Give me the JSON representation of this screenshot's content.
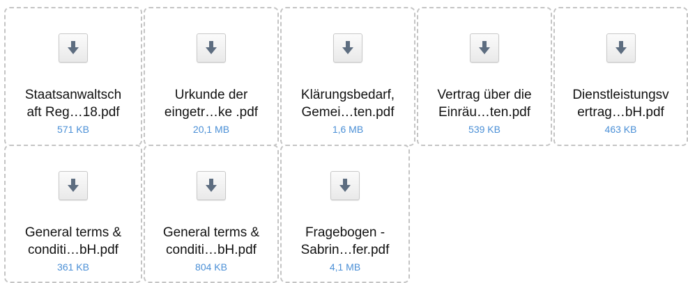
{
  "attachments": [
    {
      "line1": "Staatsanwaltsch",
      "line2": "aft Reg…18.pdf",
      "size": "571 KB",
      "icon": "download-arrow-icon"
    },
    {
      "line1": "Urkunde der",
      "line2": "eingetr…ke .pdf",
      "size": "20,1 MB",
      "icon": "download-arrow-icon"
    },
    {
      "line1": "Klärungsbedarf,",
      "line2": "Gemei…ten.pdf",
      "size": "1,6 MB",
      "icon": "download-arrow-icon"
    },
    {
      "line1": "Vertrag über die",
      "line2": "Einräu…ten.pdf",
      "size": "539 KB",
      "icon": "download-arrow-icon"
    },
    {
      "line1": "Dienstleistungsv",
      "line2": "ertrag…bH.pdf",
      "size": "463 KB",
      "icon": "download-arrow-icon"
    },
    {
      "line1": "General terms &",
      "line2": "conditi…bH.pdf",
      "size": "361 KB",
      "icon": "download-arrow-icon"
    },
    {
      "line1": "General terms &",
      "line2": "conditi…bH.pdf",
      "size": "804 KB",
      "icon": "download-arrow-icon"
    },
    {
      "line1": "Fragebogen -",
      "line2": "Sabrin…fer.pdf",
      "size": "4,1 MB",
      "icon": "download-arrow-icon"
    }
  ],
  "colors": {
    "filename_text": "#111111",
    "filesize_text": "#4a8fd6",
    "tile_border": "#c4c4c4",
    "icon_arrow": "#5d6d80"
  }
}
